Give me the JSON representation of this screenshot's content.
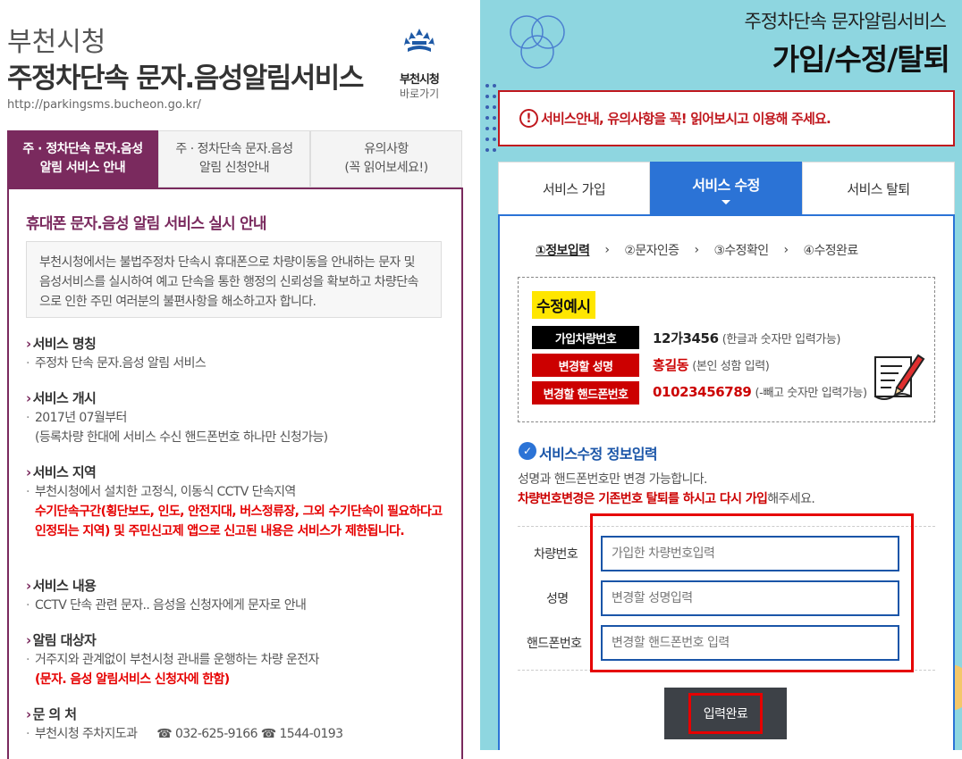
{
  "left": {
    "city": "부천시청",
    "service_title": "주정차단속 문자.음성알림서비스",
    "url": "http://parkingsms.bucheon.go.kr/",
    "logo_label": "부천시청",
    "logo_sub": "바로가기",
    "tabs": [
      {
        "line1": "주 · 정차단속 문자.음성",
        "line2": "알림 서비스 안내"
      },
      {
        "line1": "주 · 정차단속 문자.음성",
        "line2": "알림 신청안내"
      },
      {
        "line1": "유의사항",
        "line2": "(꼭 읽어보세요!)"
      }
    ],
    "heading": "휴대폰 문자.음성 알림 서비스 실시 안내",
    "intro": "부천시청에서는 불법주정차 단속시 휴대폰으로 차량이동을 안내하는 문자 및 음성서비스를 실시하여 예고 단속을 통한 행정의 신뢰성을 확보하고 차량단속으로 인한 주민 여러분의 불편사항을 해소하고자 합니다.",
    "sections": [
      {
        "title": "서비스 명칭",
        "line1": "주정차 단속 문자.음성 알림 서비스"
      },
      {
        "title": "서비스 개시",
        "line1": "2017년 07월부터",
        "line2": "(등록차량 한대에 서비스 수신 핸드폰번호 하나만 신청가능)"
      },
      {
        "title": "서비스 지역",
        "line1": "부천시청에서 설치한 고정식, 이동식 CCTV 단속지역",
        "red": "수기단속구간(횡단보도, 인도, 안전지대, 버스정류장, 그외 수기단속이 필요하다고 인정되는 지역) 및 주민신고제 앱으로 신고된 내용은 서비스가 제한됩니다."
      },
      {
        "title": "서비스 내용",
        "line1": "CCTV 단속 관련 문자.. 음성을 신청자에게 문자로 안내"
      },
      {
        "title": "알림 대상자",
        "line1": "거주지와 관계없이 부천시청 관내를 운행하는 차량 운전자",
        "red": "(문자. 음성 알림서비스 신청자에 한함)"
      },
      {
        "title": "문 의 처",
        "line1": "부천시청 주차지도과",
        "phone1": "032-625-9166",
        "phone2": "1544-0193"
      }
    ]
  },
  "right": {
    "subtitle": "주정차단속 문자알림서비스",
    "title": "가입/수정/탈퇴",
    "notice_icon": "!",
    "notice": "서비스안내, 유의사항을 꼭! 읽어보시고 이용해 주세요.",
    "tabs": [
      "서비스 가입",
      "서비스 수정",
      "서비스 탈퇴"
    ],
    "steps": [
      "①정보입력",
      "②문자인증",
      "③수정확인",
      "④수정완료"
    ],
    "example_badge": "수정예시",
    "example_rows": [
      {
        "label": "가입차량번호",
        "value": "12가3456",
        "hint": "(한글과 숫자만 입력가능)"
      },
      {
        "label": "변경할 성명",
        "value": "홍길동",
        "hint": "(본인 성함 입력)"
      },
      {
        "label": "변경할 핸드폰번호",
        "value": "01023456789",
        "hint": "(-빼고 숫자만 입력가능)"
      }
    ],
    "section_title": "서비스수정 정보입력",
    "info1": "성명과 핸드폰번호만 변경 가능합니다.",
    "info2_red": "차량번호변경은 기존번호 탈퇴를 하시고 다시 가입",
    "info2_rest": "해주세요.",
    "fields": [
      {
        "label": "차량번호",
        "placeholder": "가입한 차량번호입력"
      },
      {
        "label": "성명",
        "placeholder": "변경할 성명입력"
      },
      {
        "label": "핸드폰번호",
        "placeholder": "변경할 핸드폰번호 입력"
      }
    ],
    "submit": "입력완료"
  },
  "colors": {
    "left_accent": "#7a2a5e",
    "right_bg": "#8ed6e0",
    "blue": "#2b73d6",
    "red": "#cc0000"
  }
}
